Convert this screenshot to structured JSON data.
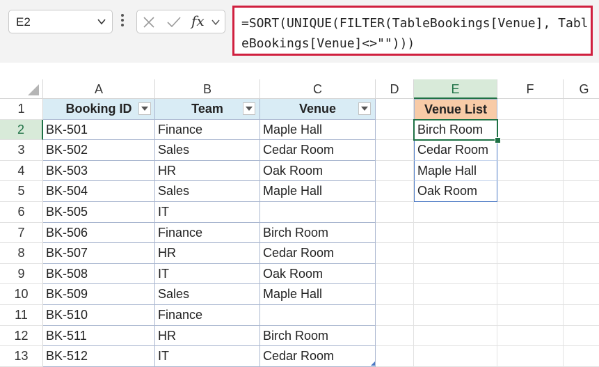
{
  "name_box": {
    "value": "E2"
  },
  "formula_bar": {
    "formula": "=SORT(UNIQUE(FILTER(TableBookings[Venue], TableBookings[Venue]<>\"\")))"
  },
  "columns": [
    "A",
    "B",
    "C",
    "D",
    "E",
    "F",
    "G"
  ],
  "selected_column": "E",
  "selected_row": "2",
  "rows": [
    "1",
    "2",
    "3",
    "4",
    "5",
    "6",
    "7",
    "8",
    "9",
    "10",
    "11",
    "12",
    "13"
  ],
  "table": {
    "headers": [
      "Booking ID",
      "Team",
      "Venue"
    ],
    "rows": [
      [
        "BK-501",
        "Finance",
        "Maple Hall"
      ],
      [
        "BK-502",
        "Sales",
        "Cedar Room"
      ],
      [
        "BK-503",
        "HR",
        "Oak Room"
      ],
      [
        "BK-504",
        "Sales",
        "Maple Hall"
      ],
      [
        "BK-505",
        "IT",
        ""
      ],
      [
        "BK-506",
        "Finance",
        "Birch Room"
      ],
      [
        "BK-507",
        "HR",
        "Cedar Room"
      ],
      [
        "BK-508",
        "IT",
        "Oak Room"
      ],
      [
        "BK-509",
        "Sales",
        "Maple Hall"
      ],
      [
        "BK-510",
        "Finance",
        ""
      ],
      [
        "BK-511",
        "HR",
        "Birch Room"
      ],
      [
        "BK-512",
        "IT",
        "Cedar Room"
      ]
    ]
  },
  "venue_list": {
    "header": "Venue List",
    "items": [
      "Birch Room",
      "Cedar Room",
      "Maple Hall",
      "Oak Room"
    ]
  },
  "colors": {
    "table_header_bg": "#d9ecf5",
    "venue_header_bg": "#f8cba7",
    "selection_green": "#1e7145",
    "formula_highlight": "#d0203f"
  }
}
